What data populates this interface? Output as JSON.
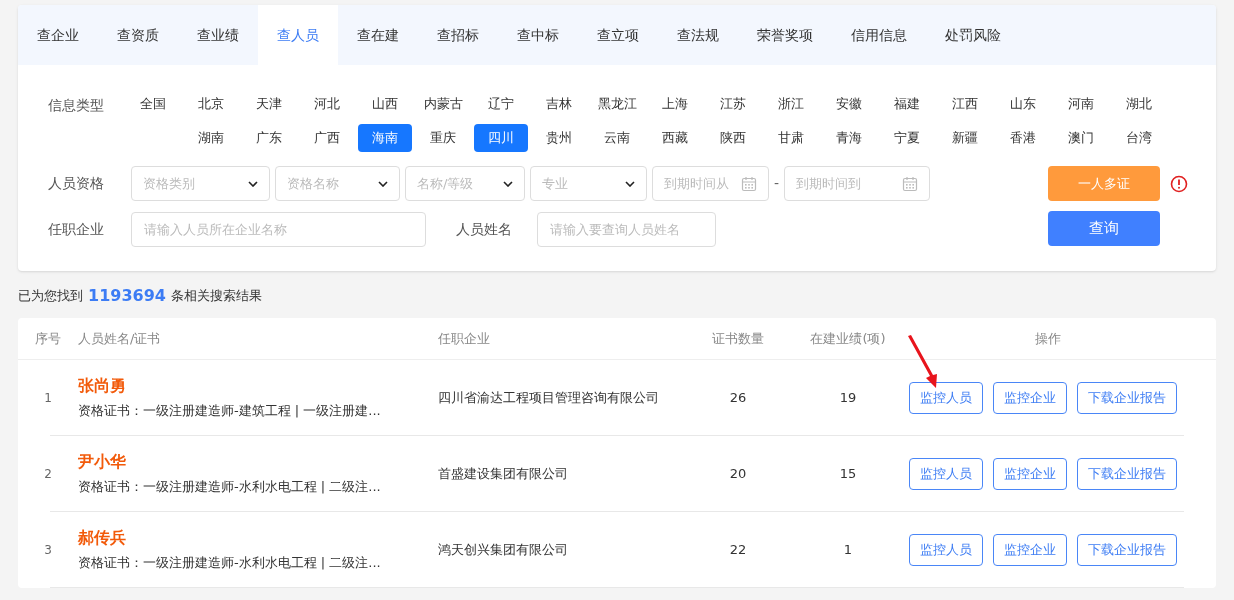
{
  "tabs": [
    {
      "label": "查企业",
      "selected": false
    },
    {
      "label": "查资质",
      "selected": false
    },
    {
      "label": "查业绩",
      "selected": false
    },
    {
      "label": "查人员",
      "selected": true
    },
    {
      "label": "查在建",
      "selected": false
    },
    {
      "label": "查招标",
      "selected": false
    },
    {
      "label": "查中标",
      "selected": false
    },
    {
      "label": "查立项",
      "selected": false
    },
    {
      "label": "查法规",
      "selected": false
    },
    {
      "label": "荣誉奖项",
      "selected": false
    },
    {
      "label": "信用信息",
      "selected": false
    },
    {
      "label": "处罚风险",
      "selected": false
    }
  ],
  "region_filter": {
    "label": "信息类型",
    "regions": [
      {
        "label": "全国",
        "selected": false
      },
      {
        "label": "北京",
        "selected": false
      },
      {
        "label": "天津",
        "selected": false
      },
      {
        "label": "河北",
        "selected": false
      },
      {
        "label": "山西",
        "selected": false
      },
      {
        "label": "内蒙古",
        "selected": false
      },
      {
        "label": "辽宁",
        "selected": false
      },
      {
        "label": "吉林",
        "selected": false
      },
      {
        "label": "黑龙江",
        "selected": false
      },
      {
        "label": "上海",
        "selected": false
      },
      {
        "label": "江苏",
        "selected": false
      },
      {
        "label": "浙江",
        "selected": false
      },
      {
        "label": "安徽",
        "selected": false
      },
      {
        "label": "福建",
        "selected": false
      },
      {
        "label": "江西",
        "selected": false
      },
      {
        "label": "山东",
        "selected": false
      },
      {
        "label": "河南",
        "selected": false
      },
      {
        "label": "湖北",
        "selected": false
      },
      {
        "label": "湖南",
        "selected": false
      },
      {
        "label": "广东",
        "selected": false
      },
      {
        "label": "广西",
        "selected": false
      },
      {
        "label": "海南",
        "selected": true
      },
      {
        "label": "重庆",
        "selected": false
      },
      {
        "label": "四川",
        "selected": true
      },
      {
        "label": "贵州",
        "selected": false
      },
      {
        "label": "云南",
        "selected": false
      },
      {
        "label": "西藏",
        "selected": false
      },
      {
        "label": "陕西",
        "selected": false
      },
      {
        "label": "甘肃",
        "selected": false
      },
      {
        "label": "青海",
        "selected": false
      },
      {
        "label": "宁夏",
        "selected": false
      },
      {
        "label": "新疆",
        "selected": false
      },
      {
        "label": "香港",
        "selected": false
      },
      {
        "label": "澳门",
        "selected": false
      },
      {
        "label": "台湾",
        "selected": false
      }
    ]
  },
  "qualification_filter": {
    "label": "人员资格",
    "fields": [
      {
        "kind": "select",
        "placeholder": "资格类别"
      },
      {
        "kind": "select",
        "placeholder": "资格名称"
      },
      {
        "kind": "select",
        "placeholder": "名称/等级"
      },
      {
        "kind": "select",
        "placeholder": "专业"
      },
      {
        "kind": "date",
        "placeholder": "到期时间从"
      },
      {
        "kind": "separator",
        "text": "-"
      },
      {
        "kind": "date",
        "placeholder": "到期时间到"
      }
    ]
  },
  "company_field": {
    "label": "任职企业",
    "placeholder": "请输入人员所在企业名称"
  },
  "name_field": {
    "label": "人员姓名",
    "placeholder": "请输入要查询人员姓名"
  },
  "multi_cert_button": "一人多证",
  "search_button": "查询",
  "result_summary": {
    "before": "已为您找到",
    "count": "1193694",
    "after": "条相关搜索结果"
  },
  "table": {
    "columns": [
      "序号",
      "人员姓名/证书",
      "任职企业",
      "证书数量",
      "在建业绩(项)",
      "操作"
    ],
    "rows": [
      {
        "index": "1",
        "name": "张尚勇",
        "certificates": "资格证书：一级注册建造师-建筑工程 | 一级注册建...",
        "company": "四川省渝达工程项目管理咨询有限公司",
        "cert_count": "26",
        "projects": "19",
        "actions": [
          "监控人员",
          "监控企业",
          "下载企业报告"
        ]
      },
      {
        "index": "2",
        "name": "尹小华",
        "certificates": "资格证书：一级注册建造师-水利水电工程 | 二级注...",
        "company": "首盛建设集团有限公司",
        "cert_count": "20",
        "projects": "15",
        "actions": [
          "监控人员",
          "监控企业",
          "下载企业报告"
        ]
      },
      {
        "index": "3",
        "name": "郝传兵",
        "certificates": "资格证书：一级注册建造师-水利水电工程 | 二级注...",
        "company": "鸿天创兴集团有限公司",
        "cert_count": "22",
        "projects": "1",
        "actions": [
          "监控人员",
          "监控企业",
          "下载企业报告"
        ]
      }
    ]
  }
}
